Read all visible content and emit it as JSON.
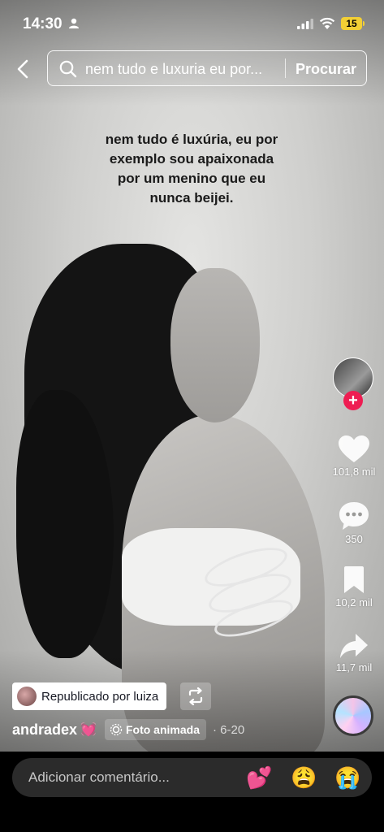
{
  "status_bar": {
    "time": "14:30",
    "battery": "15"
  },
  "search": {
    "query": "nem tudo e luxuria eu por...",
    "button_label": "Procurar"
  },
  "caption_overlay": {
    "lines": [
      "nem tudo é luxúria, eu por",
      "exemplo sou apaixonada",
      "por um menino que eu",
      "nunca beijei."
    ]
  },
  "actions": {
    "follow_symbol": "+",
    "likes": "101,8 mil",
    "comments": "350",
    "saves": "10,2 mil",
    "shares": "11,7 mil"
  },
  "repost": {
    "label": "Republicado por luiza"
  },
  "author": {
    "username": "andradex",
    "username_emoji": "💓",
    "tag_label": "Foto animada",
    "date": "· 6-20"
  },
  "comment_bar": {
    "placeholder": "Adicionar comentário...",
    "emojis": [
      "💕",
      "😩",
      "😭"
    ]
  },
  "colors": {
    "follow": "#ee1d52",
    "battery": "#f2cf35"
  },
  "icons": [
    "person-icon",
    "signal-icon",
    "wifi-icon",
    "back-icon",
    "search-icon",
    "heart-icon",
    "comment-icon",
    "bookmark-icon",
    "share-icon",
    "repost-icon",
    "photo-animated-icon"
  ]
}
